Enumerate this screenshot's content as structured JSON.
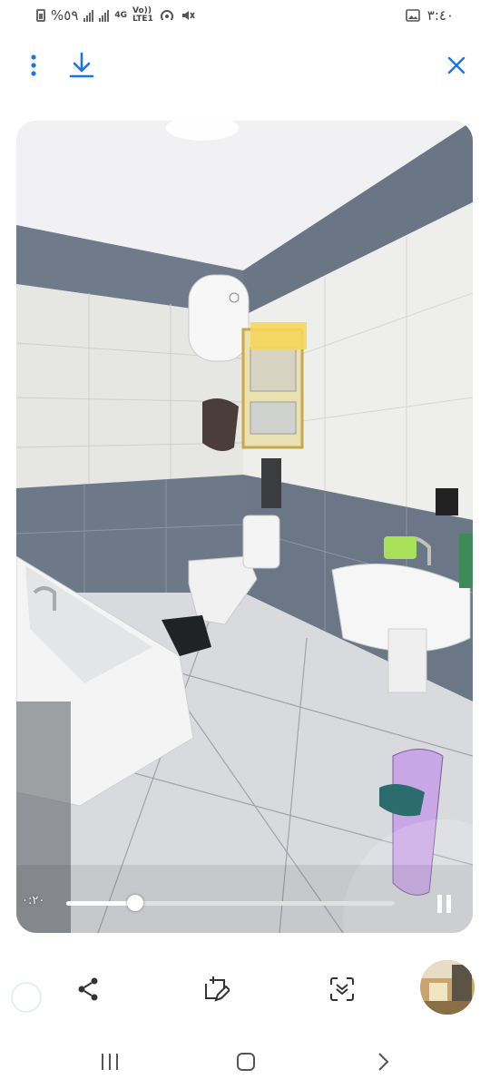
{
  "status_bar": {
    "battery_percent": "%٥٩",
    "network_type": "4G",
    "volte_label_top": "Vo))",
    "volte_label_bottom": "LTE1",
    "time": "٣:٤٠",
    "icons": [
      "battery-icon",
      "signal-icon",
      "signal-icon",
      "hotspot-icon",
      "mute-icon",
      "gallery-icon"
    ]
  },
  "toolbar": {
    "menu_icon": "more-vertical-icon",
    "download_icon": "download-icon",
    "close_icon": "close-icon",
    "accent_color": "#1a73e8"
  },
  "player": {
    "elapsed_time": "٠:٢٠",
    "progress_fraction": 0.21,
    "state": "playing",
    "pause_icon": "pause-icon"
  },
  "actions": {
    "share_icon": "share-icon",
    "edit_icon": "edit-image-icon",
    "scan_icon": "scan-icon",
    "thumbnail": "video-thumbnail"
  },
  "nav": {
    "recents_icon": "recents-icon",
    "home_icon": "home-icon",
    "back_icon": "back-icon"
  }
}
